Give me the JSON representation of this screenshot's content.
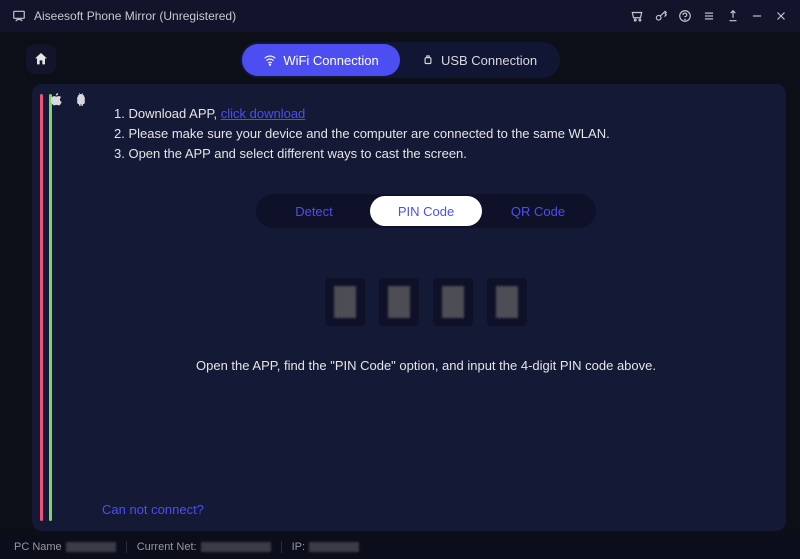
{
  "title": "Aiseesoft Phone Mirror (Unregistered)",
  "connTabs": {
    "wifi": "WiFi Connection",
    "usb": "USB Connection"
  },
  "instructions": {
    "line1a": "1. Download APP, ",
    "line1_link": "click download",
    "line2": "2. Please make sure your device and the computer are connected to the same WLAN.",
    "line3": "3. Open the APP and select different ways to cast the screen."
  },
  "methodTabs": {
    "detect": "Detect",
    "pin": "PIN Code",
    "qr": "QR Code"
  },
  "hint": "Open the APP, find the \"PIN Code\" option, and input the 4-digit PIN code above.",
  "cannotConnect": "Can not connect?",
  "status": {
    "pcName": "PC Name",
    "currentNet": "Current Net:",
    "ip": "IP:"
  }
}
